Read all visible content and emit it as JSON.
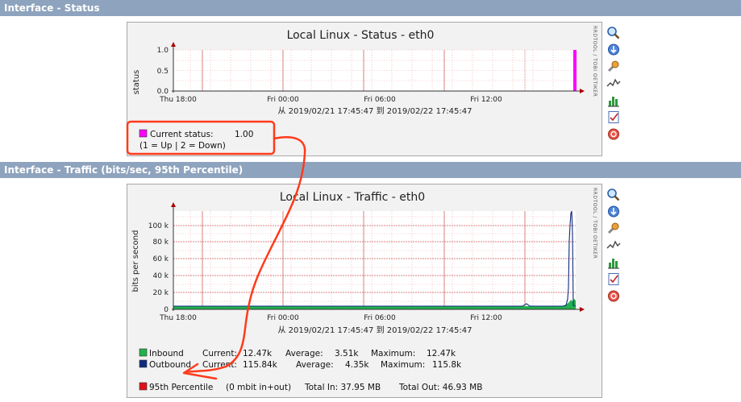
{
  "sections": {
    "status_header": "Interface - Status",
    "traffic_header": "Interface - Traffic (bits/sec, 95th Percentile)"
  },
  "watermark": "RRDTOOL / TOBI OETIKER",
  "status_graph": {
    "title": "Local Linux - Status - eth0",
    "ylabel": "status",
    "yticks": [
      "1.0",
      "0.5",
      "0.0"
    ],
    "xticks": [
      "Thu 18:00",
      "Fri 00:00",
      "Fri 06:00",
      "Fri 12:00"
    ],
    "range": "从 2019/02/21 17:45:47 到 2019/02/22 17:45:47",
    "legend": {
      "line1_label": "Current status:",
      "line1_value": "1.00",
      "line2": "(1 = Up | 2 = Down)",
      "swatch_color": "#ff00ff"
    }
  },
  "traffic_graph": {
    "title": "Local Linux - Traffic - eth0",
    "ylabel": "bits per second",
    "yticks": [
      "100 k",
      "80 k",
      "60 k",
      "40 k",
      "20 k",
      "0"
    ],
    "xticks": [
      "Thu 18:00",
      "Fri 00:00",
      "Fri 06:00",
      "Fri 12:00"
    ],
    "range": "从 2019/02/21 17:45:47 到 2019/02/22 17:45:47",
    "legend": {
      "inbound": {
        "name": "Inbound",
        "current_label": "Current:",
        "current": "12.47k",
        "average_label": "Average:",
        "average": "3.51k",
        "maximum_label": "Maximum:",
        "maximum": "12.47k",
        "color": "#22b14c"
      },
      "outbound": {
        "name": "Outbound",
        "current_label": "Current:",
        "current": "115.84k",
        "average_label": "Average:",
        "average": "4.35k",
        "maximum_label": "Maximum:",
        "maximum": "115.8k",
        "color": "#0f2a80"
      },
      "percentile": {
        "name": "95th Percentile",
        "value": "(0 mbit in+out)",
        "total_in": "Total In:  37.95 MB",
        "total_out": "Total Out:  46.93 MB",
        "color": "#e0101a"
      }
    }
  },
  "colors": {
    "header_bg": "#8ea3bd",
    "grid": "#f0a0a0",
    "annotation": "#ff3a1a"
  },
  "icons": [
    "zoom-icon",
    "download-icon",
    "properties-icon",
    "graph-line-icon",
    "graph-bars-icon",
    "report-icon",
    "close-circle-icon"
  ]
}
